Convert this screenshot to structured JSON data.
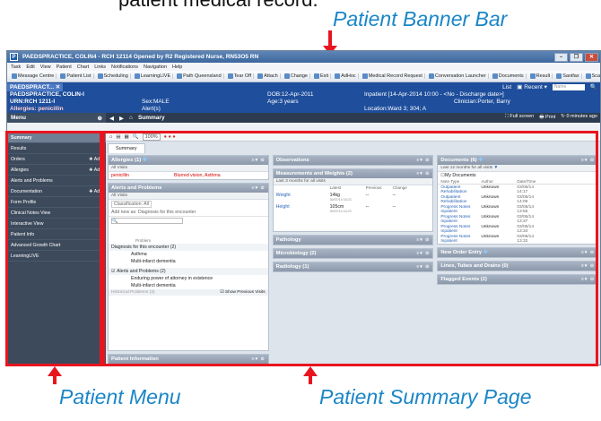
{
  "captions": {
    "top_partial": "patient medical record.",
    "banner": "Patient Banner Bar",
    "menu": "Patient Menu",
    "summary": "Patient Summary Page"
  },
  "window": {
    "title": "PAEDSPRACTICE, COLIN4 - RCH 12114    Opened by R2 Registered Nurse, RN53O5 RN",
    "menu": [
      "Task",
      "Edit",
      "View",
      "Patient",
      "Chart",
      "Links",
      "Notifications",
      "Navigation",
      "Help"
    ],
    "toolbar": [
      "Message Centre",
      "Patient List",
      "Scheduling",
      "LearningLIVE",
      "Path Queensland",
      "Tear Off",
      "Attach",
      "Change",
      "Exit",
      "AdHoc",
      "Medical Record Request",
      "Conversation Launcher",
      "Documents",
      "Result",
      "Sanifax",
      "Scan"
    ]
  },
  "banner": {
    "name": "PAEDSPRACT...",
    "name_full": "PAEDSPRACTICE, COLIN-I",
    "urn": "URN:RCH 1211-I",
    "allergies": "Allergies: penicillin",
    "dob": "DOB:12-Apr-2011",
    "age": "Age:3 years",
    "sex": "Sex:MALE",
    "alert": "Alert(s)",
    "encounter": "Inpatient [14-Apr-2014 10:00 - <No - Discharge date>]",
    "clinician": "Clinician:Porter, Barry",
    "location": "Location:Ward 3; 304; A",
    "list": "List",
    "recent": "Recent",
    "name_search": "Name"
  },
  "nav": {
    "menu_label": "Menu",
    "breadcrumb": "Summary",
    "full_screen": "Full screen",
    "print": "Print",
    "refresh": "0 minutes ago",
    "zoom": "100%"
  },
  "patient_menu": [
    {
      "label": "Summary",
      "add": ""
    },
    {
      "label": "Results",
      "add": ""
    },
    {
      "label": "Orders",
      "add": "Add"
    },
    {
      "label": "Allergies",
      "add": "Add"
    },
    {
      "label": "Alerts and Problems",
      "add": ""
    },
    {
      "label": "Documentation",
      "add": "Add"
    },
    {
      "label": "Form Profile",
      "add": ""
    },
    {
      "label": "Clinical Notes View",
      "add": ""
    },
    {
      "label": "Interactive View",
      "add": ""
    },
    {
      "label": "Patient Info",
      "add": ""
    },
    {
      "label": "Advanced Growth Chart",
      "add": ""
    },
    {
      "label": "LearningLIVE",
      "add": ""
    }
  ],
  "summary": {
    "tab": "Summary",
    "allergies": {
      "title": "Allergies (1)",
      "sub": "All Visits",
      "item": "penicillin",
      "reaction": "Blurred vision, Asthma"
    },
    "alerts": {
      "title": "Alerts and Problems",
      "sub": "All Visits",
      "classification": "Classification: All",
      "add_new": "Add new as: Diagnosis for this encounter",
      "problem_hdr": "Problem",
      "group1": "Diagnosis for this encounter (2)",
      "g1_items": [
        "Asthma",
        "Multi-infarct dementia"
      ],
      "group2": "Alerts and Problems (2)",
      "g2_items": [
        "Enduring power of attorney in existence",
        "Multi-infarct dementia"
      ],
      "historical": "Historical Problems (3)",
      "show_prev": "Show Previous Visits"
    },
    "patient_info": "Patient Information",
    "observations": "Observations",
    "measurements": {
      "title": "Measurements and Weights (2)",
      "sub": "Last 3 months for all visits",
      "cols": [
        "Latest",
        "Previous",
        "Change"
      ],
      "rows": [
        {
          "name": "Weight",
          "latest": "14kg",
          "date": "30/07/14 16:23",
          "previous": "--",
          "change": "--"
        },
        {
          "name": "Height",
          "latest": "105cm",
          "date": "30/07/14 16:23",
          "previous": "--",
          "change": "--"
        }
      ]
    },
    "pathology": "Pathology",
    "microbiology": "Microbiology (2)",
    "radiology": "Radiology (1)",
    "documents": {
      "title": "Documents (6)",
      "sub": "Last 12 months for all visits",
      "my_docs": "My Documents",
      "cols": [
        "Note Type",
        "Author",
        "Date/Time"
      ],
      "rows": [
        {
          "type": "Outpatient Rehabilitation",
          "author": "Unknown",
          "date": "03/06/14",
          "time": "14:17"
        },
        {
          "type": "Outpatient Rehabilitation",
          "author": "Unknown",
          "date": "03/06/14",
          "time": "14:09"
        },
        {
          "type": "Progress Notes Inpatient",
          "author": "Unknown",
          "date": "03/06/14",
          "time": "13:55"
        },
        {
          "type": "Progress Notes Inpatient",
          "author": "Unknown",
          "date": "03/06/14",
          "time": "13:37"
        },
        {
          "type": "Progress Notes Inpatient",
          "author": "Unknown",
          "date": "03/06/14",
          "time": "13:34"
        },
        {
          "type": "Progress Notes Inpatient",
          "author": "Unknown",
          "date": "03/06/14",
          "time": "13:32"
        }
      ]
    },
    "new_order": "New Order Entry",
    "lines": "Lines, Tubes and Drains (0)",
    "flagged": "Flagged Events (2)"
  },
  "colors": {
    "arrow": "#e8151f",
    "caption": "#1a86c7",
    "banner": "#1e4e9c",
    "menu_bg": "#3d4a5c"
  }
}
